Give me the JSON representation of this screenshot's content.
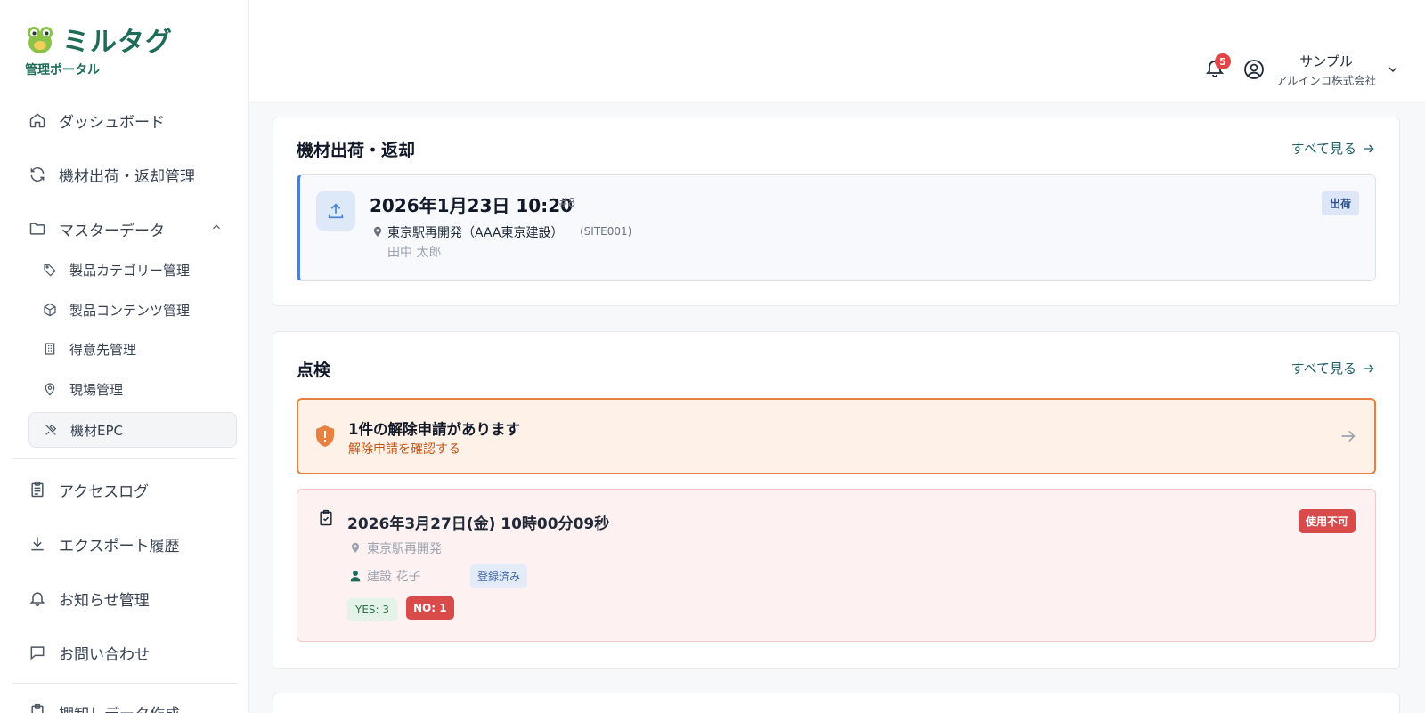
{
  "brand": {
    "logo_text": "ミルタグ",
    "subtitle": "管理ポータル"
  },
  "sidebar": {
    "items": [
      {
        "label": "ダッシュボード",
        "icon": "home-icon"
      },
      {
        "label": "機材出荷・返却管理",
        "icon": "refresh-icon"
      },
      {
        "label": "マスターデータ",
        "icon": "folder-icon",
        "expanded": true
      },
      {
        "label": "アクセスログ",
        "icon": "clipboard-icon"
      },
      {
        "label": "エクスポート履歴",
        "icon": "download-icon"
      },
      {
        "label": "お知らせ管理",
        "icon": "bell-icon"
      },
      {
        "label": "お問い合わせ",
        "icon": "chat-icon"
      },
      {
        "label": "棚卸しデータ作成",
        "icon": "clipboard-icon"
      }
    ],
    "subitems": [
      {
        "label": "製品カテゴリー管理",
        "icon": "tag-icon"
      },
      {
        "label": "製品コンテンツ管理",
        "icon": "box-icon"
      },
      {
        "label": "得意先管理",
        "icon": "building-icon"
      },
      {
        "label": "現場管理",
        "icon": "map-pin-icon"
      },
      {
        "label": "機材EPC",
        "icon": "tools-icon",
        "active": true
      }
    ]
  },
  "header": {
    "notification_count": "5",
    "user_name": "サンプル",
    "company": "アルインコ株式会社"
  },
  "shipments": {
    "title": "機材出荷・返却",
    "see_all": "すべて見る",
    "record": {
      "datetime": "2026年1月23日 10:20",
      "number": "#8",
      "site": "東京駅再開発（AAA東京建設）",
      "site_code": "(SITE001)",
      "person": "田中 太郎",
      "type": "出荷"
    }
  },
  "inspection": {
    "title": "点検",
    "see_all": "すべて見る",
    "alert": {
      "title": "1件の解除申請があります",
      "subtitle": "解除申請を確認する"
    },
    "record": {
      "datetime": "2026年3月27日(金) 10時00分09秒",
      "site": "東京駅再開発",
      "person": "建設 花子",
      "registration": "登録済み",
      "yes": "YES: 3",
      "no": "NO: 1",
      "status": "使用不可"
    }
  },
  "colors": {
    "brand": "#1f6b5a",
    "accent_blue": "#4a7fd6",
    "alert_orange": "#e8803f",
    "danger_red": "#d94a4a"
  }
}
